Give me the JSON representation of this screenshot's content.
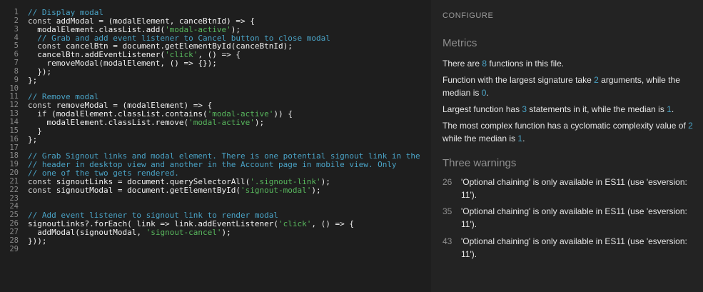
{
  "code": {
    "line_numbers": [
      "1",
      "2",
      "3",
      "4",
      "5",
      "6",
      "7",
      "8",
      "9",
      "10",
      "11",
      "12",
      "13",
      "14",
      "15",
      "16",
      "17",
      "18",
      "19",
      "20",
      "21",
      "22",
      "23",
      "24",
      "25",
      "26",
      "27",
      "28",
      "29"
    ],
    "lines": [
      [
        {
          "t": "c",
          "v": "// Display modal"
        }
      ],
      [
        {
          "t": "k",
          "v": "const"
        },
        {
          "t": "p",
          "v": " addModal = (modalElement, canceBtnId) => {"
        }
      ],
      [
        {
          "t": "p",
          "v": "  modalElement.classList.add("
        },
        {
          "t": "s",
          "v": "'modal-active'"
        },
        {
          "t": "p",
          "v": ");"
        }
      ],
      [
        {
          "t": "c",
          "v": "  // Grab and add event listener to Cancel button to close modal"
        }
      ],
      [
        {
          "t": "k",
          "v": "  const"
        },
        {
          "t": "p",
          "v": " cancelBtn = document.getElementById(canceBtnId);"
        }
      ],
      [
        {
          "t": "p",
          "v": "  cancelBtn.addEventListener("
        },
        {
          "t": "s",
          "v": "'click'"
        },
        {
          "t": "p",
          "v": ", () => {"
        }
      ],
      [
        {
          "t": "p",
          "v": "    removeModal(modalElement, () => {});"
        }
      ],
      [
        {
          "t": "p",
          "v": "  });"
        }
      ],
      [
        {
          "t": "p",
          "v": "};"
        }
      ],
      [
        {
          "t": "p",
          "v": ""
        }
      ],
      [
        {
          "t": "c",
          "v": "// Remove modal"
        }
      ],
      [
        {
          "t": "k",
          "v": "const"
        },
        {
          "t": "p",
          "v": " removeModal = (modalElement) => {"
        }
      ],
      [
        {
          "t": "k",
          "v": "  if"
        },
        {
          "t": "p",
          "v": " (modalElement.classList.contains("
        },
        {
          "t": "s",
          "v": "'modal-active'"
        },
        {
          "t": "p",
          "v": ")) {"
        }
      ],
      [
        {
          "t": "p",
          "v": "    modalElement.classList.remove("
        },
        {
          "t": "s",
          "v": "'modal-active'"
        },
        {
          "t": "p",
          "v": ");"
        }
      ],
      [
        {
          "t": "p",
          "v": "  }"
        }
      ],
      [
        {
          "t": "p",
          "v": "};"
        }
      ],
      [
        {
          "t": "p",
          "v": ""
        }
      ],
      [
        {
          "t": "c",
          "v": "// Grab Signout links and modal element. There is one potential signout link in the"
        }
      ],
      [
        {
          "t": "c",
          "v": "// header in desktop view and another in the Account page in mobile view. Only"
        }
      ],
      [
        {
          "t": "c",
          "v": "// one of the two gets rendered."
        }
      ],
      [
        {
          "t": "k",
          "v": "const"
        },
        {
          "t": "p",
          "v": " signoutLinks = document.querySelectorAll("
        },
        {
          "t": "s",
          "v": "'.signout-link'"
        },
        {
          "t": "p",
          "v": ");"
        }
      ],
      [
        {
          "t": "k",
          "v": "const"
        },
        {
          "t": "p",
          "v": " signoutModal = document.getElementById("
        },
        {
          "t": "s",
          "v": "'signout-modal'"
        },
        {
          "t": "p",
          "v": ");"
        }
      ],
      [
        {
          "t": "p",
          "v": ""
        }
      ],
      [
        {
          "t": "p",
          "v": ""
        }
      ],
      [
        {
          "t": "c",
          "v": "// Add event listener to signout link to render modal"
        }
      ],
      [
        {
          "t": "p",
          "v": "signoutLinks?.forEach( link => link.addEventListener("
        },
        {
          "t": "s",
          "v": "'click'"
        },
        {
          "t": "p",
          "v": ", () => {"
        }
      ],
      [
        {
          "t": "p",
          "v": "  addModal(signoutModal, "
        },
        {
          "t": "s",
          "v": "'signout-cancel'"
        },
        {
          "t": "p",
          "v": ");"
        }
      ],
      [
        {
          "t": "p",
          "v": "}));"
        }
      ],
      [
        {
          "t": "p",
          "v": ""
        }
      ]
    ]
  },
  "sidebar": {
    "configure_label": "CONFIGURE",
    "metrics_heading": "Metrics",
    "metrics": {
      "p1_a": "There are ",
      "p1_n": "8",
      "p1_b": " functions in this file.",
      "p2_a": "Function with the largest signature take ",
      "p2_n": "2",
      "p2_b": " arguments, while the median is ",
      "p2_m": "0",
      "p2_c": ".",
      "p3_a": "Largest function has ",
      "p3_n": "3",
      "p3_b": " statements in it, while the median is ",
      "p3_m": "1",
      "p3_c": ".",
      "p4_a": "The most complex function has a cyclomatic complexity value of ",
      "p4_n": "2",
      "p4_b": " while the median is ",
      "p4_m": "1",
      "p4_c": "."
    },
    "warnings_heading": "Three warnings",
    "warnings": [
      {
        "line": "26",
        "text": "'Optional chaining' is only available in ES11 (use 'esversion: 11')."
      },
      {
        "line": "35",
        "text": "'Optional chaining' is only available in ES11 (use 'esversion: 11')."
      },
      {
        "line": "43",
        "text": "'Optional chaining' is only available in ES11 (use 'esversion: 11')."
      }
    ]
  }
}
